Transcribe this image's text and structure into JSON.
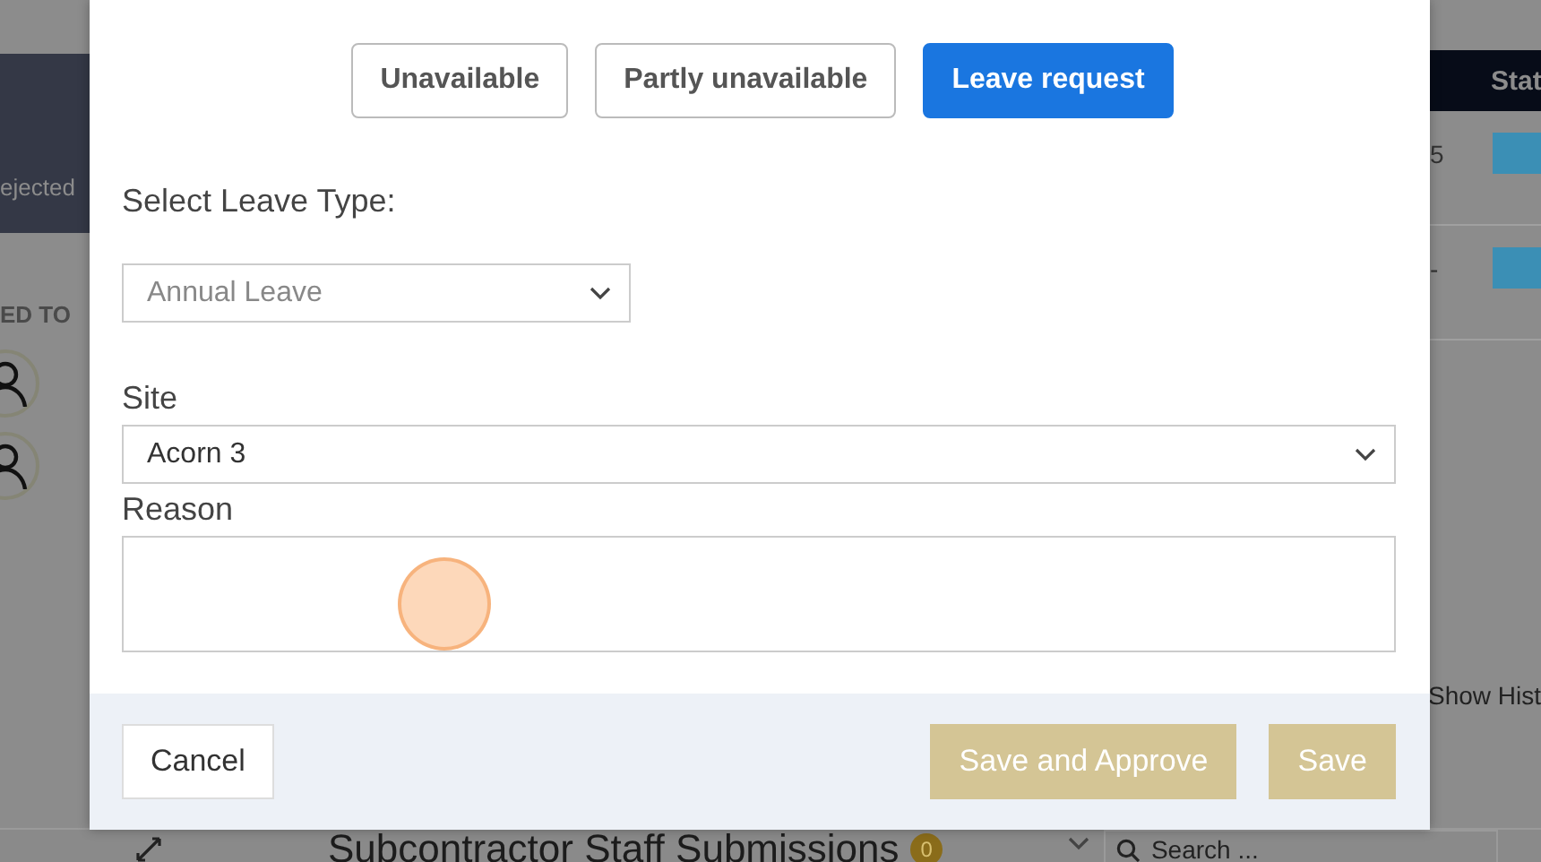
{
  "background": {
    "stat_card": {
      "label": "ejected"
    },
    "section_heading": "ED TO",
    "people": [
      {
        "kind": "avatar"
      },
      {
        "kind": "avatar"
      }
    ],
    "table": {
      "columns": [
        "Stat"
      ],
      "rows": [
        {
          "column_1": "5"
        },
        {
          "column_1": "-"
        }
      ]
    },
    "show_history_link": "Show Hist",
    "panel": {
      "title": "Subcontractor Staff Submissions",
      "count": "0",
      "search": {
        "placeholder": "Search ..."
      }
    }
  },
  "modal": {
    "mode_tabs": [
      {
        "label": "Unavailable",
        "selected": false
      },
      {
        "label": "Partly unavailable",
        "selected": false
      },
      {
        "label": "Leave request",
        "selected": true
      }
    ],
    "leave_type": {
      "label": "Select Leave Type:",
      "value": "Annual Leave",
      "disabled": true
    },
    "site": {
      "label": "Site",
      "value": "Acorn 3",
      "disabled": false
    },
    "reason": {
      "label": "Reason"
    },
    "buttons": [
      {
        "kind": "secondary",
        "label": "Cancel",
        "disabled": false
      },
      {
        "kind": "primary",
        "label": "Save and Approve",
        "disabled": true
      },
      {
        "kind": "primary",
        "label": "Save",
        "disabled": true
      }
    ]
  }
}
